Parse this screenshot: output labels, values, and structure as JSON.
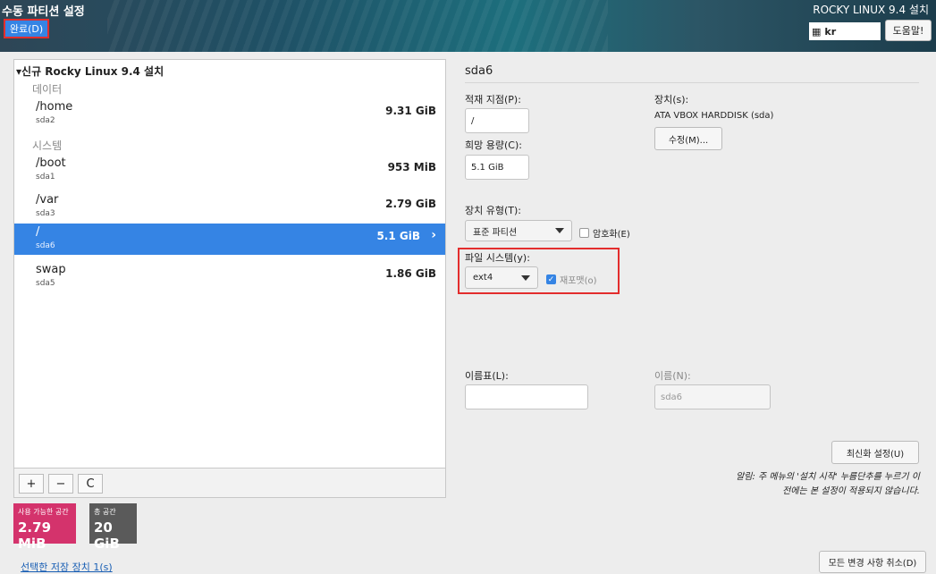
{
  "header": {
    "page_title": "수동 파티션 설정",
    "done_label": "완료(D)",
    "product_title": "ROCKY LINUX 9.4 설치",
    "keyboard_layout": "kr",
    "help_label": "도움말!"
  },
  "tree": {
    "title": "▾신규 Rocky Linux 9.4 설치",
    "groups": {
      "data_label": "데이터",
      "system_label": "시스템"
    },
    "mounts": [
      {
        "name": "/home",
        "device": "sda2",
        "size": "9.31 GiB"
      },
      {
        "name": "/boot",
        "device": "sda1",
        "size": "953 MiB"
      },
      {
        "name": "/var",
        "device": "sda3",
        "size": "2.79 GiB"
      },
      {
        "name": "/",
        "device": "sda6",
        "size": "5.1 GiB"
      },
      {
        "name": "swap",
        "device": "sda5",
        "size": "1.86 GiB"
      }
    ],
    "selected_index": 3
  },
  "toolbar": {
    "add": "+",
    "remove": "−",
    "refresh": "C"
  },
  "space": {
    "available_label": "사용 가능한 공간",
    "available_value": "2.79 MiB",
    "total_label": "총 공간",
    "total_value": "20 GiB"
  },
  "storage_link": "선택한 저장 장치 1(s)",
  "details": {
    "title": "sda6",
    "mount_point_label": "적재 지점(P):",
    "mount_point_value": "/",
    "desired_capacity_label": "희망 용량(C):",
    "desired_capacity_value": "5.1 GiB",
    "devices_label": "장치(s):",
    "devices_value": "ATA VBOX HARDDISK (sda)",
    "modify_label": "수정(M)...",
    "device_type_label": "장치 유형(T):",
    "device_type_value": "표준 파티션",
    "encrypt_label": "암호화(E)",
    "filesystem_label": "파일 시스템(y):",
    "filesystem_value": "ext4",
    "reformat_label": "재포맷(o)",
    "label_label": "이름표(L):",
    "label_value": "",
    "name_label": "이름(N):",
    "name_value": "sda6",
    "update_label": "최신화 설정(U)",
    "note_line1": "알림: 주 메뉴의 '설치 시작' 누름단추를 누르기 이",
    "note_line2": "전에는 본 설정이 적용되지 않습니다.",
    "reset_all_label": "모든 변경 사항 취소(D)"
  },
  "colors": {
    "accent": "#3584e4",
    "available_bg": "#d4336c",
    "total_bg": "#5a5a5a",
    "highlight": "#e32d2d"
  }
}
